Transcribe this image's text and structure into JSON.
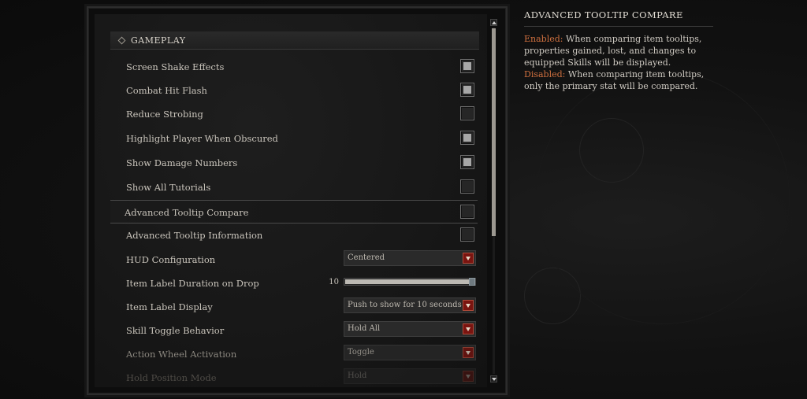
{
  "section": {
    "title": "GAMEPLAY"
  },
  "rows": [
    {
      "label": "Screen Shake Effects",
      "type": "checkbox",
      "checked": true
    },
    {
      "label": "Combat Hit Flash",
      "type": "checkbox",
      "checked": true
    },
    {
      "label": "Reduce Strobing",
      "type": "checkbox",
      "checked": false
    },
    {
      "label": "Highlight Player When Obscured",
      "type": "checkbox",
      "checked": true
    },
    {
      "label": "Show Damage Numbers",
      "type": "checkbox",
      "checked": true
    },
    {
      "label": "Show All Tutorials",
      "type": "checkbox",
      "checked": false
    },
    {
      "label": "Advanced Tooltip Compare",
      "type": "checkbox",
      "checked": false,
      "selected": true
    },
    {
      "label": "Advanced Tooltip Information",
      "type": "checkbox",
      "checked": false
    },
    {
      "label": "HUD Configuration",
      "type": "dropdown",
      "value": "Centered"
    },
    {
      "label": "Item Label Duration on Drop",
      "type": "slider",
      "value": "10",
      "fraction": 0.97
    },
    {
      "label": "Item Label Display",
      "type": "dropdown",
      "value": "Push to show for 10 seconds"
    },
    {
      "label": "Skill Toggle Behavior",
      "type": "dropdown",
      "value": "Hold All"
    },
    {
      "label": "Action Wheel Activation",
      "type": "dropdown",
      "value": "Toggle"
    },
    {
      "label": "Hold Position Mode",
      "type": "dropdown",
      "value": "Hold"
    }
  ],
  "tooltip": {
    "title": "ADVANCED TOOLTIP COMPARE",
    "enabled_label": "Enabled:",
    "enabled_text": " When comparing item tooltips, properties gained, lost, and changes to equipped Skills will be displayed.",
    "disabled_label": "Disabled:",
    "disabled_text": " When comparing item tooltips, only the primary stat will be compared."
  },
  "scroll": {
    "position_fraction": 0.0,
    "visible_fraction": 0.6
  },
  "colors": {
    "accent": "#d0703f",
    "dropdown_arrow": "#7a1410",
    "checkbox_fill": "#a7a7a7"
  }
}
